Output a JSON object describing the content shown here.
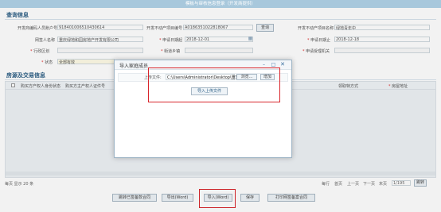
{
  "window": {
    "title": "模板与审核信息登录（开发商提供）"
  },
  "query": {
    "title": "查询信息",
    "fields": [
      {
        "label": "开发商编码人员账户号",
        "value": "918401006510430614",
        "required": true
      },
      {
        "label": "开发不动产项目编号",
        "value": "A0186351022818067",
        "required": false
      },
      {
        "label": "开发不动产项目名称",
        "value": "绿地青年中",
        "required": false
      },
      {
        "label": "网签人名称",
        "value": "重庆绿地和园房地产开发有限公司",
        "required": false
      },
      {
        "label": "申请日期起",
        "value": "2018-12-01",
        "required": true
      },
      {
        "label": "申请日期止",
        "value": "2018-12-18",
        "required": true
      },
      {
        "label": "行政区划",
        "value": "",
        "required": true
      },
      {
        "label": "街道乡镇",
        "value": "",
        "required": true
      },
      {
        "label": "申请受理机关",
        "value": "",
        "required": true
      },
      {
        "label": "状态",
        "value": "全部有效",
        "required": true
      }
    ],
    "search_label": "查询"
  },
  "records": {
    "title": "房源及交易信息",
    "columns": [
      "购买方产权人身份状态",
      "购买方主产权人证件号",
      "领取特方式",
      "房屋地址"
    ],
    "required_col": "房屋地址",
    "footer_left": "每页 显示 20 条",
    "pager": {
      "prefix": "每行",
      "first": "首页",
      "prev": "上一页",
      "next": "下一页",
      "last": "末页",
      "page": "1/195",
      "go": "跳转"
    }
  },
  "actions": [
    "跳转已签备款合同",
    "导出(Word)",
    "导入(Word)",
    "保存",
    "打印网签备案合同"
  ],
  "modal": {
    "title": "导入家庭成员",
    "upload_label": "上传文件:",
    "file_path": "C:\\Users\\Administrator\\Desktop\\重复",
    "browse_label": "浏览...",
    "add_label": "增加",
    "import_label": "导入上传文件"
  },
  "colors": {
    "accent": "#2a5d84",
    "highlight": "#d9262c",
    "titlebar": "#a8c8dc"
  },
  "icons": {
    "close": "close-icon",
    "minimize": "minimize-icon",
    "maximize": "maximize-icon",
    "calendar": "calendar-icon"
  }
}
